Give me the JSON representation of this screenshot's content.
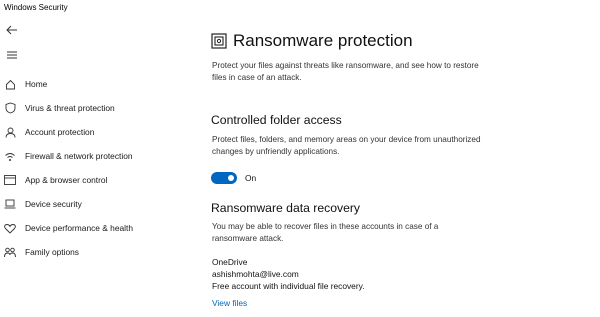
{
  "window": {
    "title": "Windows Security"
  },
  "sidebar": {
    "items": [
      {
        "label": "Home",
        "icon": "home-icon"
      },
      {
        "label": "Virus & threat protection",
        "icon": "shield-icon"
      },
      {
        "label": "Account protection",
        "icon": "person-icon"
      },
      {
        "label": "Firewall & network protection",
        "icon": "wifi-icon"
      },
      {
        "label": "App & browser control",
        "icon": "browser-window-icon"
      },
      {
        "label": "Device security",
        "icon": "laptop-icon"
      },
      {
        "label": "Device performance & health",
        "icon": "heart-icon"
      },
      {
        "label": "Family options",
        "icon": "family-icon"
      }
    ]
  },
  "main": {
    "title": "Ransomware protection",
    "description_line1": "Protect your files against threats like ransomware, and see how to restore",
    "description_line2": "files in case of an attack.",
    "cfa": {
      "title": "Controlled folder access",
      "desc_line1": "Protect files, folders, and memory areas on your device from unauthorized",
      "desc_line2": "changes by unfriendly applications.",
      "toggle_label": "On",
      "toggle_state": "on"
    },
    "recovery": {
      "title": "Ransomware data recovery",
      "desc_line1": "You may be able to recover files in these accounts in case of a",
      "desc_line2": "ransomware attack.",
      "service": "OneDrive",
      "account": "ashishmohta@live.com",
      "plan": "Free account with individual file recovery.",
      "link": "View files"
    }
  },
  "colors": {
    "accent": "#0067c0"
  }
}
